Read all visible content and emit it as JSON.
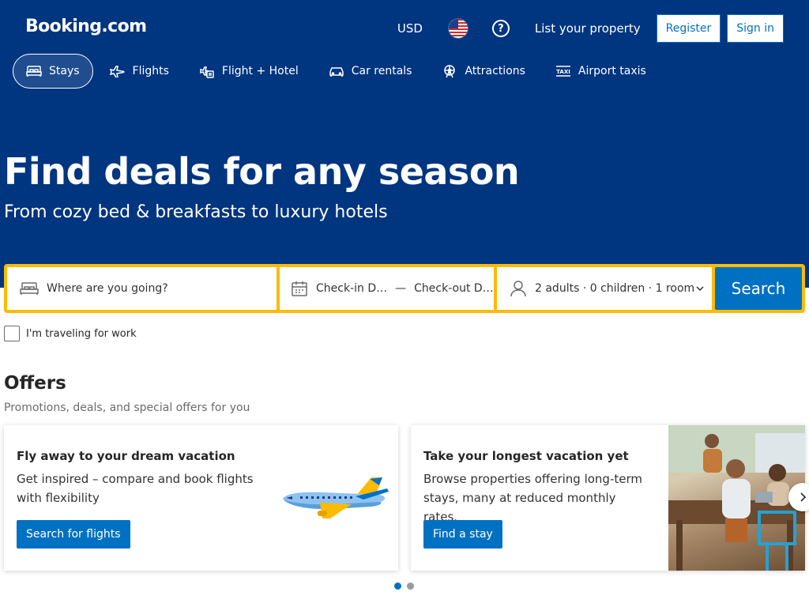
{
  "header": {
    "logo": "Booking.com",
    "currency": "USD",
    "list_property": "List your property",
    "register": "Register",
    "sign_in": "Sign in"
  },
  "nav": {
    "items": [
      {
        "label": "Stays",
        "icon": "bed-icon",
        "active": true
      },
      {
        "label": "Flights",
        "icon": "plane-icon"
      },
      {
        "label": "Flight + Hotel",
        "icon": "flight-hotel-icon"
      },
      {
        "label": "Car rentals",
        "icon": "car-icon"
      },
      {
        "label": "Attractions",
        "icon": "ferris-wheel-icon"
      },
      {
        "label": "Airport taxis",
        "icon": "taxi-icon"
      }
    ]
  },
  "hero": {
    "title": "Find deals for any season",
    "subtitle": "From cozy bed & breakfasts to luxury hotels"
  },
  "search": {
    "destination_placeholder": "Where are you going?",
    "checkin": "Check-in D…",
    "date_separator": "—",
    "checkout": "Check-out D…",
    "guests": "2 adults · 0 children · 1 room",
    "button": "Search",
    "work_travel": "I'm traveling for work"
  },
  "offers": {
    "title": "Offers",
    "subtitle": "Promotions, deals, and special offers for you",
    "cards": [
      {
        "title": "Fly away to your dream vacation",
        "body": "Get inspired – compare and book flights with flexibility",
        "button": "Search for flights"
      },
      {
        "title": "Take your longest vacation yet",
        "body": "Browse properties offering long-term stays, many at reduced monthly rates.",
        "button": "Find a stay"
      }
    ],
    "active_page": 1,
    "page_count": 2
  },
  "colors": {
    "brand_blue": "#003580",
    "action_blue": "#0071c2",
    "search_border": "#febb02"
  }
}
